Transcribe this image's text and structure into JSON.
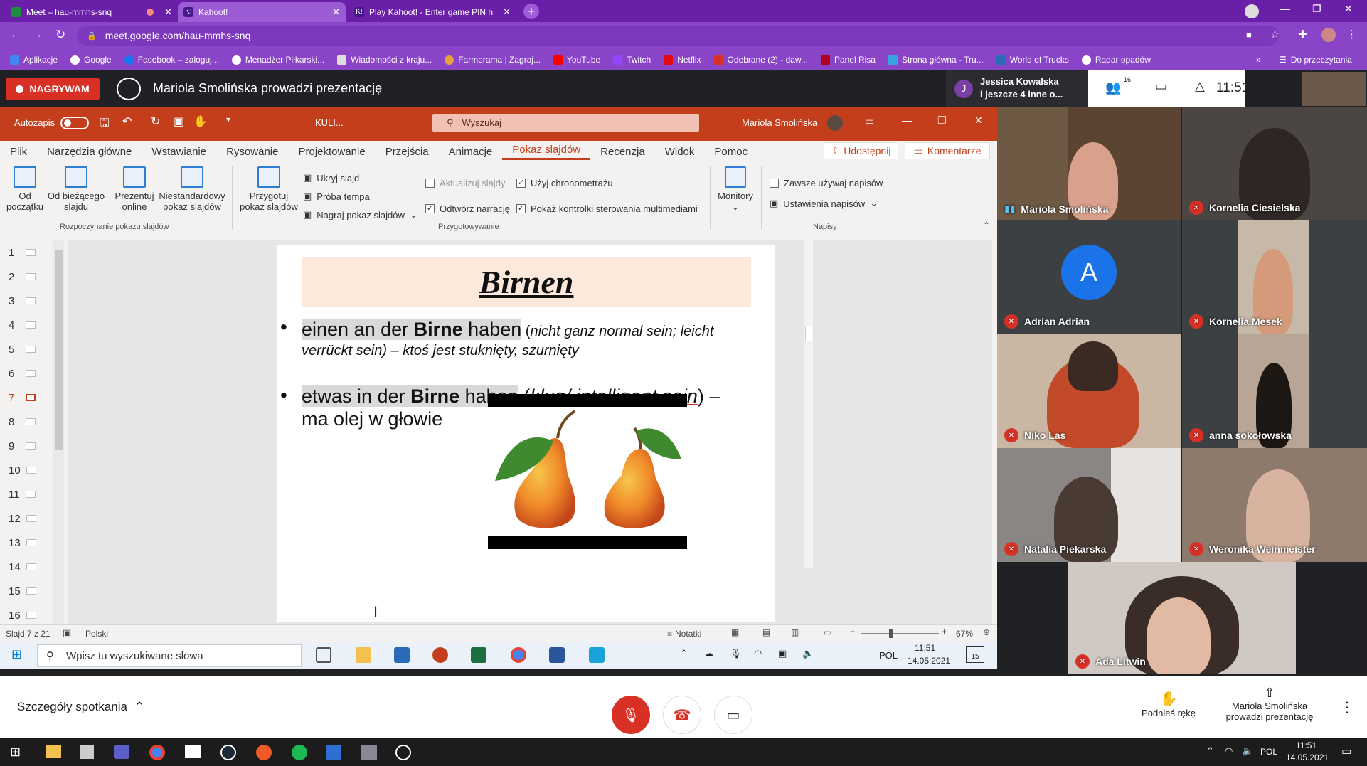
{
  "browser": {
    "tabs": [
      {
        "label": "Meet – hau-mmhs-snq",
        "color": "#1e8e3e"
      },
      {
        "label": "Kahoot!",
        "color": "#46178f"
      },
      {
        "label": "Play Kahoot! - Enter game PIN h",
        "color": "#46178f"
      }
    ],
    "url": "meet.google.com/hau-mmhs-snq",
    "bookmarks": [
      "Aplikacje",
      "Google",
      "Facebook – zaloguj...",
      "Menadżer Piłkarski...",
      "Wiadomości z kraju...",
      "Farmerama | Zagraj...",
      "YouTube",
      "Twitch",
      "Netflix",
      "Odebrane (2) - daw...",
      "Panel Risa",
      "Strona główna - Tru...",
      "World of Trucks",
      "Radar opadów"
    ],
    "reading_list": "Do przeczytania"
  },
  "meet": {
    "recording_label": "NAGRYWAM",
    "presenting_text": "Mariola Smolińska prowadzi prezentację",
    "participant_summary_line1": "Jessica Kowalska",
    "participant_summary_line2": "i jeszcze 4 inne o...",
    "avatar_letter": "J",
    "participants_count": "16",
    "clock": "11:51",
    "meeting_details": "Szczegóły spotkania",
    "raise_hand": "Podnieś rękę",
    "presenter_line1": "Mariola Smolińska",
    "presenter_line2": "prowadzi prezentację",
    "tiles": [
      {
        "name": "Mariola Smolińska",
        "muted": false
      },
      {
        "name": "Kornelia Ciesielska",
        "muted": true
      },
      {
        "name": "Adrian Adrian",
        "muted": true,
        "avatar": "A"
      },
      {
        "name": "Kornelia Mesek",
        "muted": true
      },
      {
        "name": "Niko Las",
        "muted": true
      },
      {
        "name": "anna sokołowska",
        "muted": true
      },
      {
        "name": "Natalia Piekarska",
        "muted": true
      },
      {
        "name": "Weronika Weinmeister",
        "muted": true
      },
      {
        "name": "Ada Litwin",
        "muted": true
      }
    ]
  },
  "ppt": {
    "autosave": "Autozapis",
    "filename": "KULI...",
    "search_placeholder": "Wyszukaj",
    "user": "Mariola Smolińska",
    "ribbon_tabs": [
      "Plik",
      "Narzędzia główne",
      "Wstawianie",
      "Rysowanie",
      "Projektowanie",
      "Przejścia",
      "Animacje",
      "Pokaz slajdów",
      "Recenzja",
      "Widok",
      "Pomoc"
    ],
    "active_tab": "Pokaz slajdów",
    "share": "Udostępnij",
    "comments": "Komentarze",
    "btn_from_start": [
      "Od",
      "początku"
    ],
    "btn_from_current": [
      "Od bieżącego",
      "slajdu"
    ],
    "btn_present_online": [
      "Prezentuj",
      "online"
    ],
    "btn_custom": [
      "Niestandardowy",
      "pokaz slajdów"
    ],
    "group_start": "Rozpoczynanie pokazu slajdów",
    "btn_setup": [
      "Przygotuj",
      "pokaz slajdów"
    ],
    "hide_slide": "Ukryj slajd",
    "rehearse": "Próba tempa",
    "record": "Nagraj pokaz slajdów",
    "update_slides": "Aktualizuj slajdy",
    "play_narration": "Odtwórz narrację",
    "use_timings": "Użyj chronometrażu",
    "show_media_controls": "Pokaż kontrolki sterowania multimediami",
    "group_setup": "Przygotowywanie",
    "monitors": "Monitory",
    "always_captions": "Zawsze używaj napisów",
    "caption_settings": "Ustawienia napisów",
    "group_captions": "Napisy",
    "slide_numbers": [
      "1",
      "2",
      "3",
      "4",
      "5",
      "6",
      "7",
      "8",
      "9",
      "10",
      "11",
      "12",
      "13",
      "14",
      "15",
      "16"
    ],
    "current_slide": "7",
    "status_slide": "Slajd 7 z 21",
    "language": "Polski",
    "notes": "Notatki",
    "zoom": "67%"
  },
  "slide": {
    "title": "Birnen",
    "b1_hl_pre": "einen an der ",
    "b1_bold": "Birne",
    "b1_hl_post": " haben",
    "b1_paren_open": " (",
    "b1_italic": "nicht ganz normal sein; leicht",
    "b1_line2_italic": "verrückt sein",
    "b1_line2_rest": ") – ktoś jest stuknięty, szurnięty",
    "b2_hl_pre": "etwas in der ",
    "b2_bold": "Birne",
    "b2_hl_post": " haben",
    "b2_paren": " (",
    "b2_it1": "klug/",
    "b2_it2": "intelligent sein",
    "b2_tail": ") –",
    "b2_line2": "ma olej w głowie"
  },
  "taskbar1": {
    "search_placeholder": "Wpisz tu wyszukiwane słowa",
    "lang": "POL",
    "time": "11:51",
    "date": "14.05.2021",
    "notif": "15"
  },
  "taskbar2": {
    "lang": "POL",
    "time": "11:51",
    "date": "14.05.2021"
  }
}
